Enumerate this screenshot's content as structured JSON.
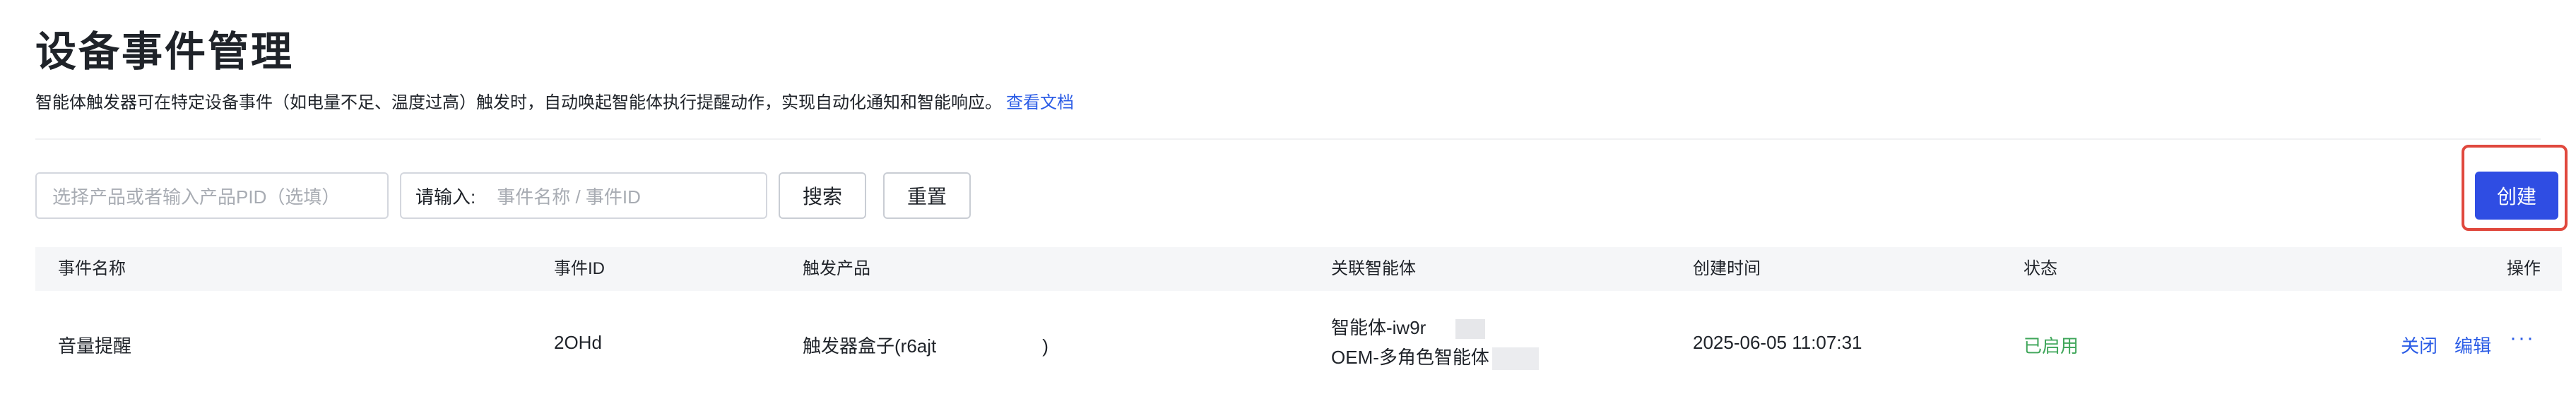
{
  "page": {
    "title": "设备事件管理",
    "description": "智能体触发器可在特定设备事件（如电量不足、温度过高）触发时，自动唤起智能体执行提醒动作，实现自动化通知和智能响应。",
    "doc_link": "查看文档"
  },
  "filters": {
    "product_placeholder": "选择产品或者输入产品PID（选填）",
    "keyword_prefix": "请输入:",
    "keyword_placeholder": "事件名称 / 事件ID",
    "search_label": "搜索",
    "reset_label": "重置",
    "create_label": "创建"
  },
  "table": {
    "columns": {
      "name": "事件名称",
      "id": "事件ID",
      "product": "触发产品",
      "agents": "关联智能体",
      "created": "创建时间",
      "status": "状态",
      "actions": "操作"
    },
    "rows": [
      {
        "name": "音量提醒",
        "id": "2OHd",
        "product_a": "触发器盒子(r6ajt",
        "product_b": ")",
        "agent_1": "智能体-iw9r",
        "agent_2": "OEM-多角色智能体",
        "created": "2025-06-05 11:07:31",
        "status": "已启用",
        "close": "关闭",
        "edit": "编辑",
        "more": "···"
      }
    ]
  },
  "colors": {
    "accent": "#2f4de3",
    "link": "#2b5ce6",
    "status_enabled": "#3fa65a",
    "highlight": "#e0483d"
  }
}
